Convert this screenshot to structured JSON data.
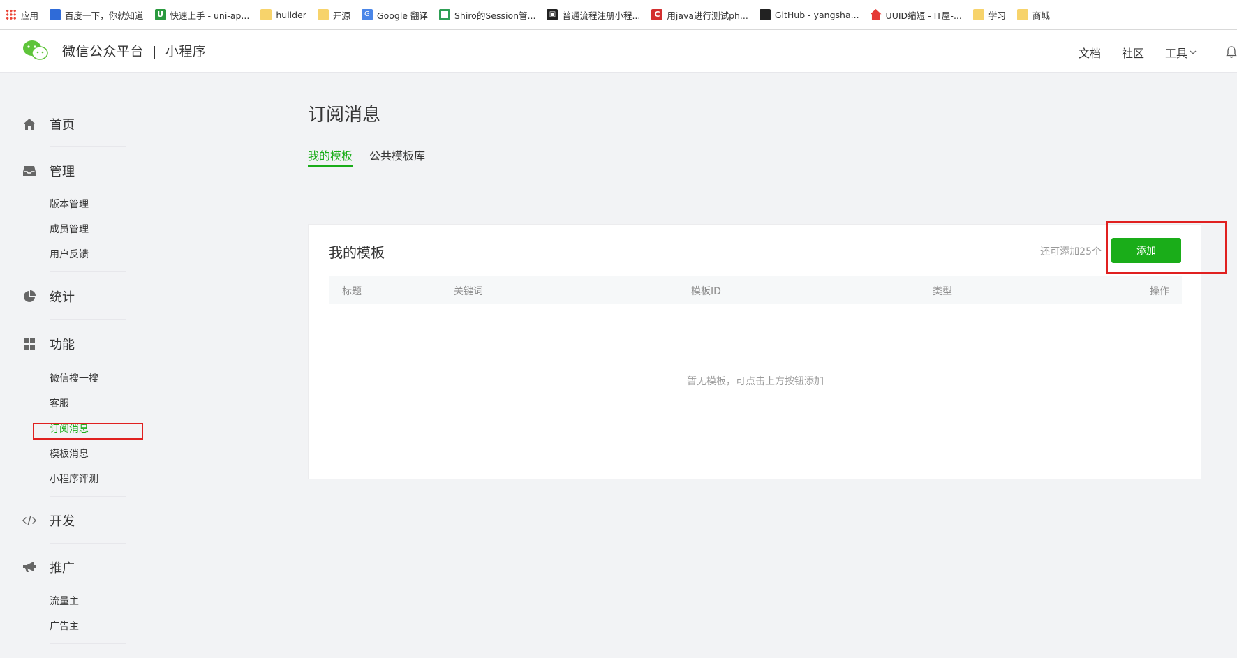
{
  "bookmarks": [
    {
      "label": "应用",
      "icon": "apps-grid-icon",
      "cls": "ico-apps"
    },
    {
      "label": "百度一下，你就知道",
      "icon": "baidu-paw-icon",
      "cls": "ico-paw"
    },
    {
      "label": "快速上手 - uni-ap...",
      "icon": "uniapp-icon",
      "cls": "ico-u",
      "glyph": "U"
    },
    {
      "label": "huilder",
      "icon": "folder-icon",
      "cls": "ico-folder"
    },
    {
      "label": "开源",
      "icon": "folder-icon",
      "cls": "ico-folder"
    },
    {
      "label": "Google 翻译",
      "icon": "google-translate-icon",
      "cls": "ico-gt",
      "glyph": "G"
    },
    {
      "label": "Shiro的Session管...",
      "icon": "c-logo-icon",
      "cls": "ico-c"
    },
    {
      "label": "普通流程注册小程...",
      "icon": "dark-site-icon",
      "cls": "ico-dark",
      "glyph": "▣"
    },
    {
      "label": "用java进行测试ph...",
      "icon": "csdn-icon",
      "cls": "ico-red",
      "glyph": "C"
    },
    {
      "label": "GitHub - yangsha...",
      "icon": "github-icon",
      "cls": "ico-gh"
    },
    {
      "label": "UUID缩短 - IT屋-...",
      "icon": "house-icon",
      "cls": "ico-house"
    },
    {
      "label": "学习",
      "icon": "folder-icon",
      "cls": "ico-folder"
    },
    {
      "label": "商城",
      "icon": "folder-icon",
      "cls": "ico-folder"
    }
  ],
  "header": {
    "brand_main": "微信公众平台",
    "brand_sep": "|",
    "brand_sub": "小程序",
    "nav": {
      "docs": "文档",
      "community": "社区",
      "tools": "工具"
    }
  },
  "sidebar": {
    "home": "首页",
    "manage": "管理",
    "manage_items": [
      "版本管理",
      "成员管理",
      "用户反馈"
    ],
    "stats": "统计",
    "features": "功能",
    "feature_items": [
      "微信搜一搜",
      "客服",
      "订阅消息",
      "模板消息",
      "小程序评测"
    ],
    "develop": "开发",
    "promote": "推广",
    "promote_items": [
      "流量主",
      "广告主"
    ]
  },
  "main": {
    "page_title": "订阅消息",
    "tabs": [
      "我的模板",
      "公共模板库"
    ],
    "card": {
      "title": "我的模板",
      "remaining": "还可添加25个",
      "add_button": "添加",
      "columns": [
        "标题",
        "关键词",
        "模板ID",
        "类型",
        "操作"
      ],
      "empty": "暂无模板，可点击上方按钮添加"
    }
  },
  "colors": {
    "accent": "#1aad19",
    "annotation": "#e02020"
  }
}
